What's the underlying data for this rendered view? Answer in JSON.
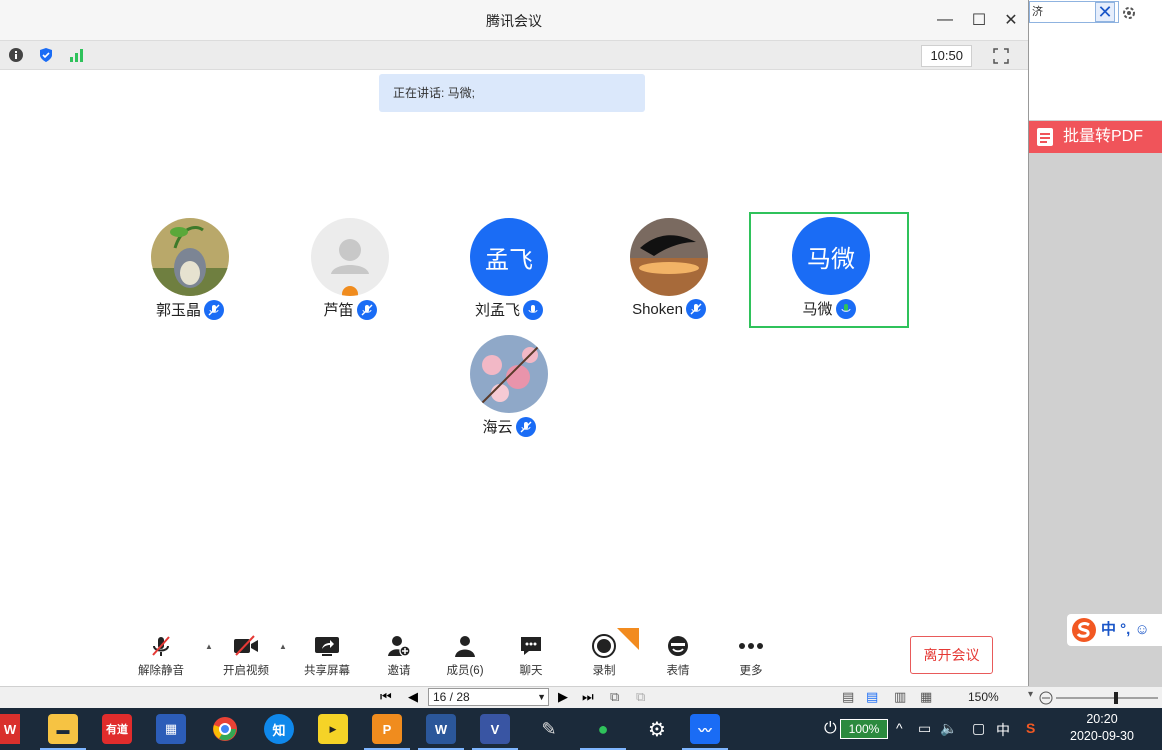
{
  "window": {
    "title": "腾讯会议",
    "clock": "10:50",
    "speaking_text": "正在讲话: 马微;"
  },
  "participants": [
    {
      "name": "郭玉晶",
      "avatar": "photo-totoro",
      "initials": ""
    },
    {
      "name": "芦笛",
      "avatar": "default-person",
      "initials": ""
    },
    {
      "name": "刘孟飞",
      "avatar": "initials",
      "initials": "孟飞"
    },
    {
      "name": "Shoken",
      "avatar": "photo-dolphins-sunset",
      "initials": ""
    },
    {
      "name": "马微",
      "avatar": "initials",
      "initials": "马微",
      "active": true
    },
    {
      "name": "海云",
      "avatar": "photo-blossom",
      "initials": ""
    }
  ],
  "toolbar": {
    "unmute": "解除静音",
    "video": "开启视频",
    "share": "共享屏幕",
    "invite": "邀请",
    "members": "成员(6)",
    "chat": "聊天",
    "record": "录制",
    "record_badge": "NEW",
    "emoji": "表情",
    "more": "更多",
    "leave": "离开会议"
  },
  "right_pane": {
    "search_text": "济",
    "banner": "批量转PDF",
    "ime": "中 °, ☺"
  },
  "nav": {
    "page": "16 / 28",
    "zoom": "150%"
  },
  "taskbar": {
    "battery": "100%",
    "ime_lang": "中",
    "time": "20:20",
    "date": "2020-09-30",
    "apps": [
      "wps",
      "file-explorer",
      "youdao",
      "calendar",
      "chrome",
      "zhihu",
      "player",
      "pdf",
      "word",
      "visio",
      "paint",
      "wechat",
      "settings",
      "tencent-meeting"
    ]
  },
  "colors": {
    "accent": "#1a6cf5",
    "active_border": "#2fc25b",
    "leave": "#e53935"
  }
}
